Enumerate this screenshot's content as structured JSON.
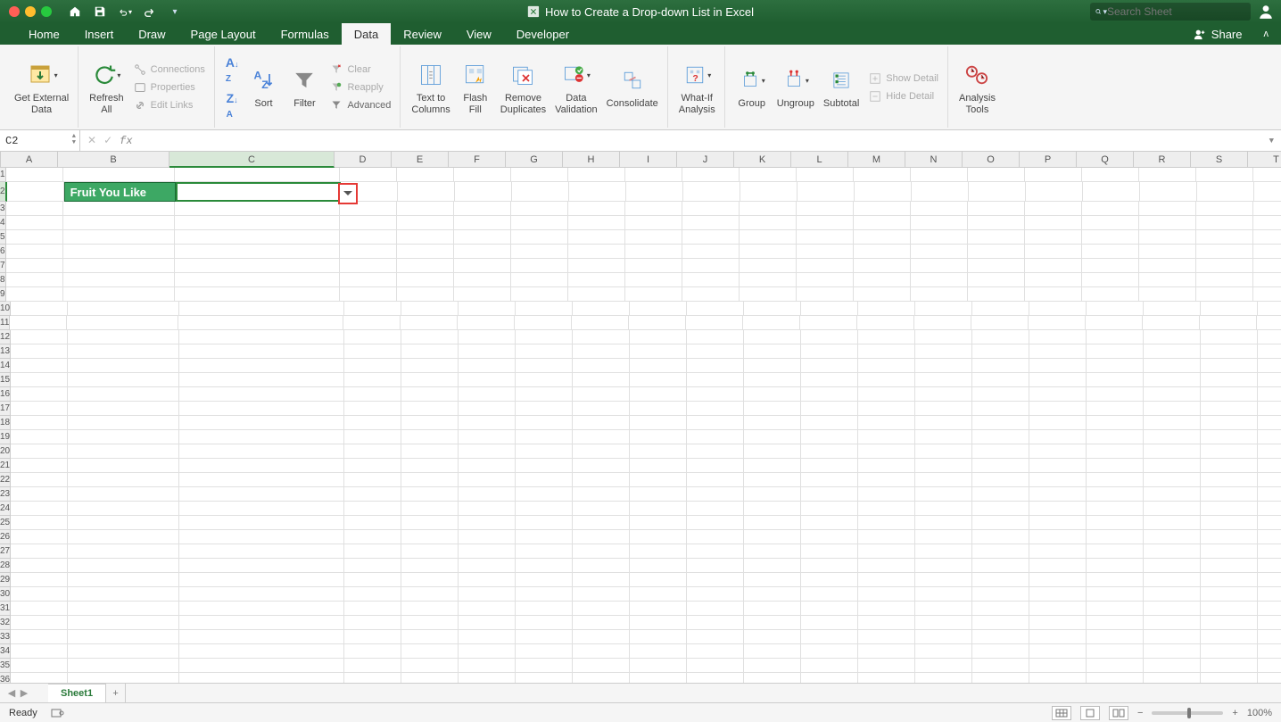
{
  "window": {
    "title": "How to Create a Drop-down List in Excel",
    "search_placeholder": "Search Sheet",
    "share_label": "Share"
  },
  "tabs": [
    "Home",
    "Insert",
    "Draw",
    "Page Layout",
    "Formulas",
    "Data",
    "Review",
    "View",
    "Developer"
  ],
  "active_tab": "Data",
  "ribbon": {
    "get_external_data": "Get External\nData",
    "refresh_all": "Refresh\nAll",
    "connections": "Connections",
    "properties": "Properties",
    "edit_links": "Edit Links",
    "sort": "Sort",
    "filter": "Filter",
    "clear": "Clear",
    "reapply": "Reapply",
    "advanced": "Advanced",
    "text_to_columns": "Text to\nColumns",
    "flash_fill": "Flash\nFill",
    "remove_duplicates": "Remove\nDuplicates",
    "data_validation": "Data\nValidation",
    "consolidate": "Consolidate",
    "what_if": "What-If\nAnalysis",
    "group": "Group",
    "ungroup": "Ungroup",
    "subtotal": "Subtotal",
    "show_detail": "Show Detail",
    "hide_detail": "Hide Detail",
    "analysis_tools": "Analysis\nTools"
  },
  "namebox": "C2",
  "columns": [
    "A",
    "B",
    "C",
    "D",
    "E",
    "F",
    "G",
    "H",
    "I",
    "J",
    "K",
    "L",
    "M",
    "N",
    "O",
    "P",
    "Q",
    "R",
    "S",
    "T"
  ],
  "selected_col": "C",
  "selected_row": 2,
  "row_count": 36,
  "cell_b2": "Fruit You Like",
  "sheet_tabs": [
    "Sheet1"
  ],
  "status": "Ready",
  "zoom": "100%"
}
